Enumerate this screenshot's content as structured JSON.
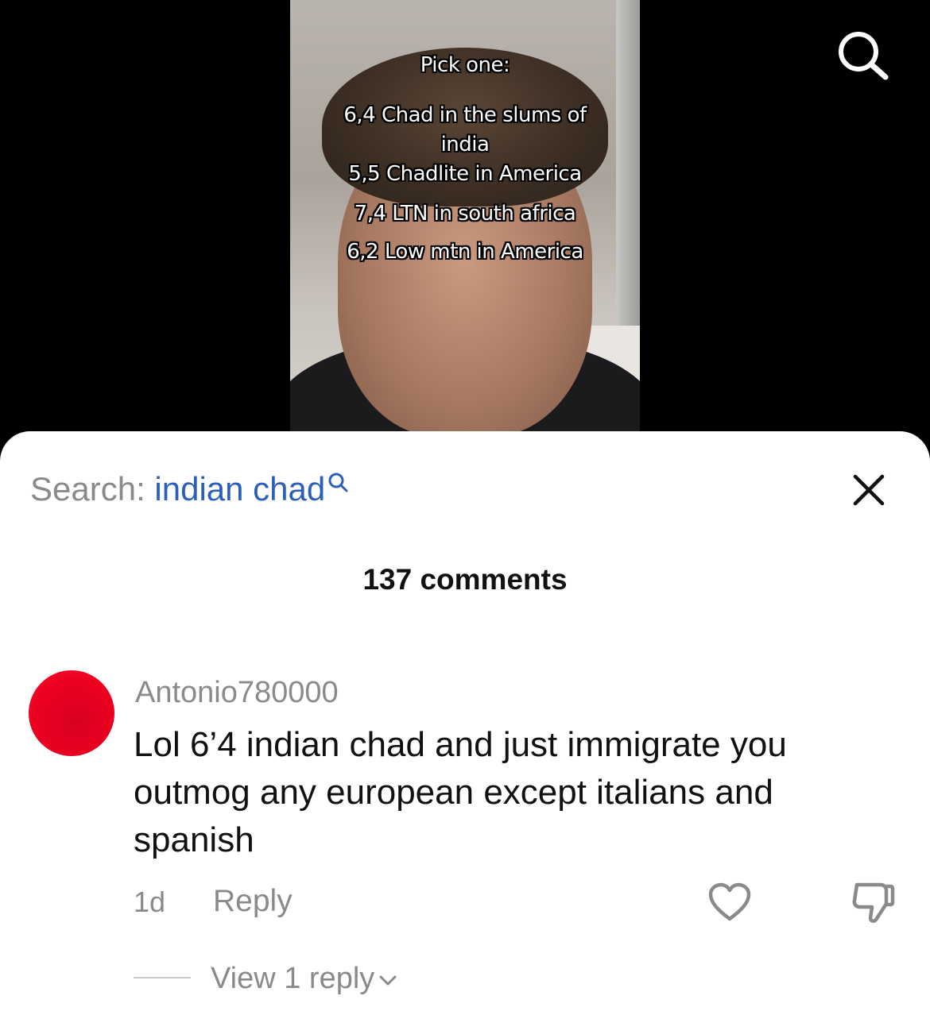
{
  "video": {
    "overlay": {
      "heading": "Pick one:",
      "options": [
        "6,4 Chad in the slums of",
        "india",
        "5,5 Chadlite in America",
        "7,4 LTN in south africa",
        "6,2 Low mtn in America"
      ]
    },
    "top_icon": "search-icon"
  },
  "sheet": {
    "search_label": "Search:",
    "search_term": "indian chad",
    "close_icon": "close-icon",
    "comment_count": "137 comments"
  },
  "comments": [
    {
      "username": "Antonio780000",
      "avatar_color": "#ec0020",
      "text": "Lol 6’4 indian chad and just immigrate you outmog any european except italians and spanish",
      "time": "1d",
      "reply_label": "Reply",
      "view_replies_label": "View 1 reply"
    }
  ],
  "colors": {
    "link_blue": "#2b5fb8",
    "muted_gray": "#8a8a8a"
  }
}
